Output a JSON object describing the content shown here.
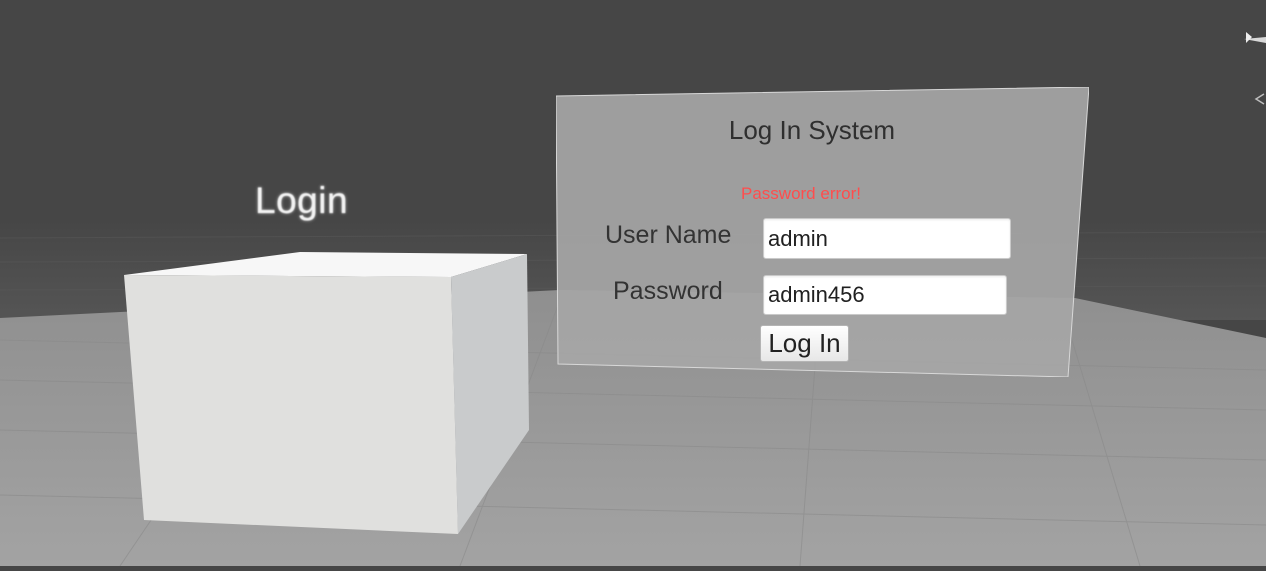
{
  "scene": {
    "world_label": "Login"
  },
  "login_panel": {
    "title": "Log In System",
    "error_message": "Password error!",
    "username_label": "User Name",
    "username_value": "admin",
    "password_label": "Password",
    "password_value": "admin456",
    "login_button_label": "Log In"
  },
  "colors": {
    "sky": "#464646",
    "ground": "#9c9c9c",
    "error": "#ff4d4d",
    "panel": "#a5a5a5"
  }
}
